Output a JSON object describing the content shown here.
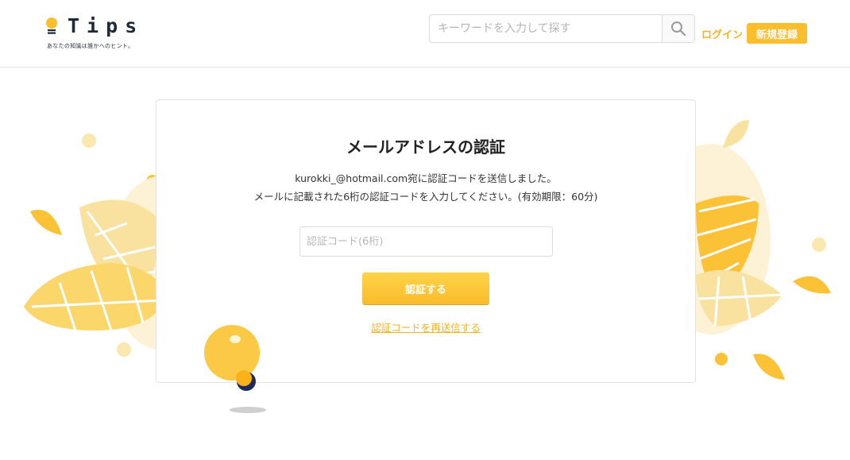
{
  "header": {
    "logo_text": "Tips",
    "logo_tagline": "あなたの知識は誰かへのヒント。",
    "search_placeholder": "キーワードを入力して探す",
    "search_icon": "search-icon",
    "login_label": "ログイン",
    "signup_label": "新規登録"
  },
  "card": {
    "title": "メールアドレスの認証",
    "message_line1": "kurokki_@hotmail.com宛に認証コードを送信しました。",
    "message_line2": "メールに記載された6桁の認証コードを入力してください。(有効期限：60分)",
    "code_placeholder": "認証コード(6桁)",
    "code_value": "",
    "verify_label": "認証する",
    "resend_label": "認証コードを再送信する"
  },
  "colors": {
    "brand_yellow": "#fbbe2f",
    "link_yellow": "#f4b324",
    "logo_navy": "#1e2a3a",
    "leaf_light": "#f9e2a0",
    "leaf_mid": "#fbd66a",
    "leaf_deep": "#fbc238",
    "blob_bg": "#fdf1d6"
  }
}
